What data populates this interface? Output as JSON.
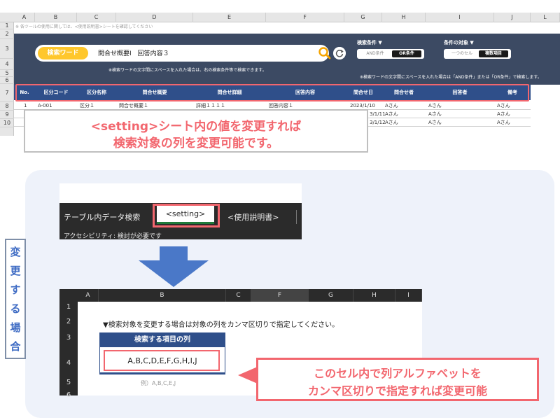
{
  "sheet_top": {
    "columns": [
      "A",
      "B",
      "C",
      "D",
      "E",
      "F",
      "G",
      "H",
      "I",
      "J",
      "L"
    ],
    "rows": [
      "1",
      "2",
      "3",
      "4",
      "5",
      "6",
      "7",
      "8",
      "9",
      "10"
    ],
    "note": "※ 各ツールの使用に関しては、<使用説明書>シートを確認してください",
    "search": {
      "tag_label": "検索ワード",
      "value": "問合せ概要Ⅰ　回答内容３",
      "note": "※検索ワードの文字間にスペースを入れた場合は、右の検索条件等で検索できます。"
    },
    "condition": {
      "label": "検索条件 ▼",
      "option_off": "AND条件",
      "option_on": "OR条件"
    },
    "target": {
      "label": "条件の対象 ▼",
      "option_off": "一つのセル",
      "option_on": "複数項目"
    },
    "right_note": "※検索ワードの文字間にスペースを入れた場合は「AND条件」または「OR条件」で検索します。",
    "table_headers": [
      "No.",
      "区分コード",
      "区分名称",
      "問合せ概要",
      "問合せ詳細",
      "回答内容",
      "問合せ日",
      "問合せ者",
      "回答者",
      "備考"
    ],
    "rows_data": [
      [
        "1",
        "A-001",
        "区分１",
        "問合せ概要１",
        "詳細１１１１",
        "回答内容１",
        "2023/1/10",
        "Aさん",
        "Aさん",
        "Aさん"
      ],
      [
        "",
        "",
        "",
        "",
        "",
        "",
        "3/1/11",
        "Aさん",
        "Aさん",
        "Aさん"
      ],
      [
        "",
        "",
        "",
        "",
        "",
        "",
        "3/1/12",
        "Aさん",
        "Aさん",
        "Aさん"
      ]
    ],
    "callout_line1": "<setting>シート内の値を変更すれば",
    "callout_line2": "検索対象の列を変更可能です。"
  },
  "side_label": [
    "変",
    "更",
    "す",
    "る",
    "場",
    "合"
  ],
  "tabbar": {
    "tab_left": "テーブル内データ検索",
    "tab_active": "<setting>",
    "tab_right": "<使用説明書>",
    "access_note": "アクセシビリティ: 検討が必要です"
  },
  "sheet2": {
    "columns": [
      "A",
      "B",
      "C",
      "F",
      "G",
      "H",
      "I"
    ],
    "rows": [
      "1",
      "2",
      "3",
      "4",
      "5",
      "6"
    ],
    "instruction": "▼検索対象を変更する場合は対象の列をカンマ区切りで指定してください。",
    "box_header": "検索する項目の列",
    "box_value": "A,B,C,D,E,F,G,H,I,J",
    "example": "例）A,B,C,E,J"
  },
  "callout_bottom": {
    "line1": "このセル内で列アルファベットを",
    "line2": "カンマ区切りで指定すれば変更可能"
  },
  "colors": {
    "accent_red": "#f2666e",
    "header_blue": "#2f4f8a",
    "panel_navy": "#3c4a63",
    "search_yellow": "#ffc72c",
    "side_blue": "#3f6cc4",
    "arrow_blue": "#4a78c8"
  }
}
